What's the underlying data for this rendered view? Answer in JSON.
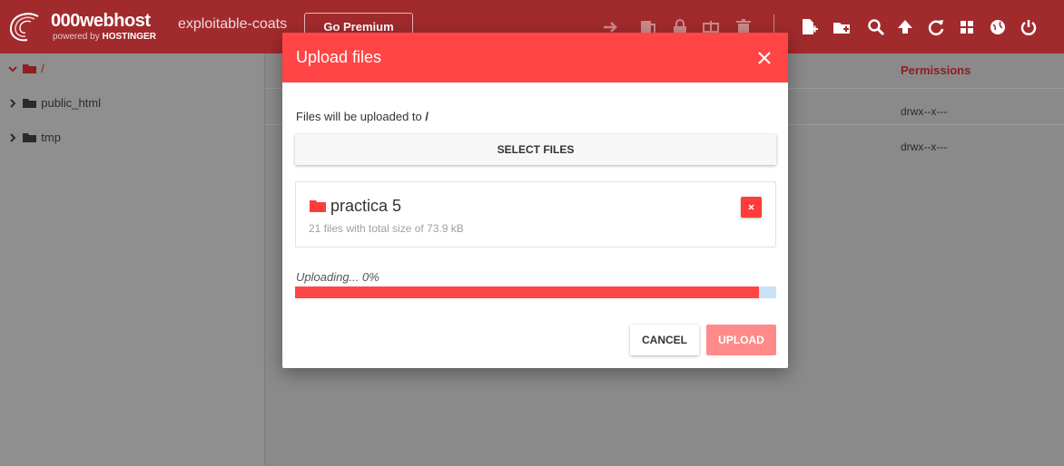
{
  "header": {
    "brand": "000webhost",
    "powered_by_prefix": "powered by",
    "powered_by_brand": "HOSTINGER",
    "site_name": "exploitable-coats",
    "premium_label": "Go Premium",
    "accent_color": "#a12a2d"
  },
  "toolbar": {
    "disabled_icons": [
      "move-icon",
      "copy-icon",
      "permissions-lock-icon",
      "rename-icon",
      "delete-icon"
    ],
    "enabled_icons": [
      "new-file-icon",
      "new-folder-icon",
      "search-icon",
      "upload-icon",
      "refresh-icon",
      "grid-view-icon",
      "globe-icon",
      "logout-icon"
    ]
  },
  "sidebar": {
    "root_label": "/",
    "items": [
      {
        "label": "public_html"
      },
      {
        "label": "tmp"
      }
    ]
  },
  "file_list": {
    "permissions_header": "Permissions",
    "rows": [
      {
        "permissions": "drwx--x---"
      },
      {
        "permissions": "drwx--x---"
      }
    ]
  },
  "modal": {
    "title": "Upload files",
    "destination_prefix": "Files will be uploaded to",
    "destination_path": "/",
    "select_label": "SELECT FILES",
    "file": {
      "name": "practica 5",
      "meta": "21 files with total size of 73.9 kB"
    },
    "status_text": "Uploading... 0%",
    "progress_bar_fill": 0.965,
    "cancel_label": "CANCEL",
    "upload_label": "UPLOAD",
    "colors": {
      "header": "#ff4545",
      "progress_track": "#c9e2f5",
      "upload_button": "#ff8a8a"
    }
  }
}
